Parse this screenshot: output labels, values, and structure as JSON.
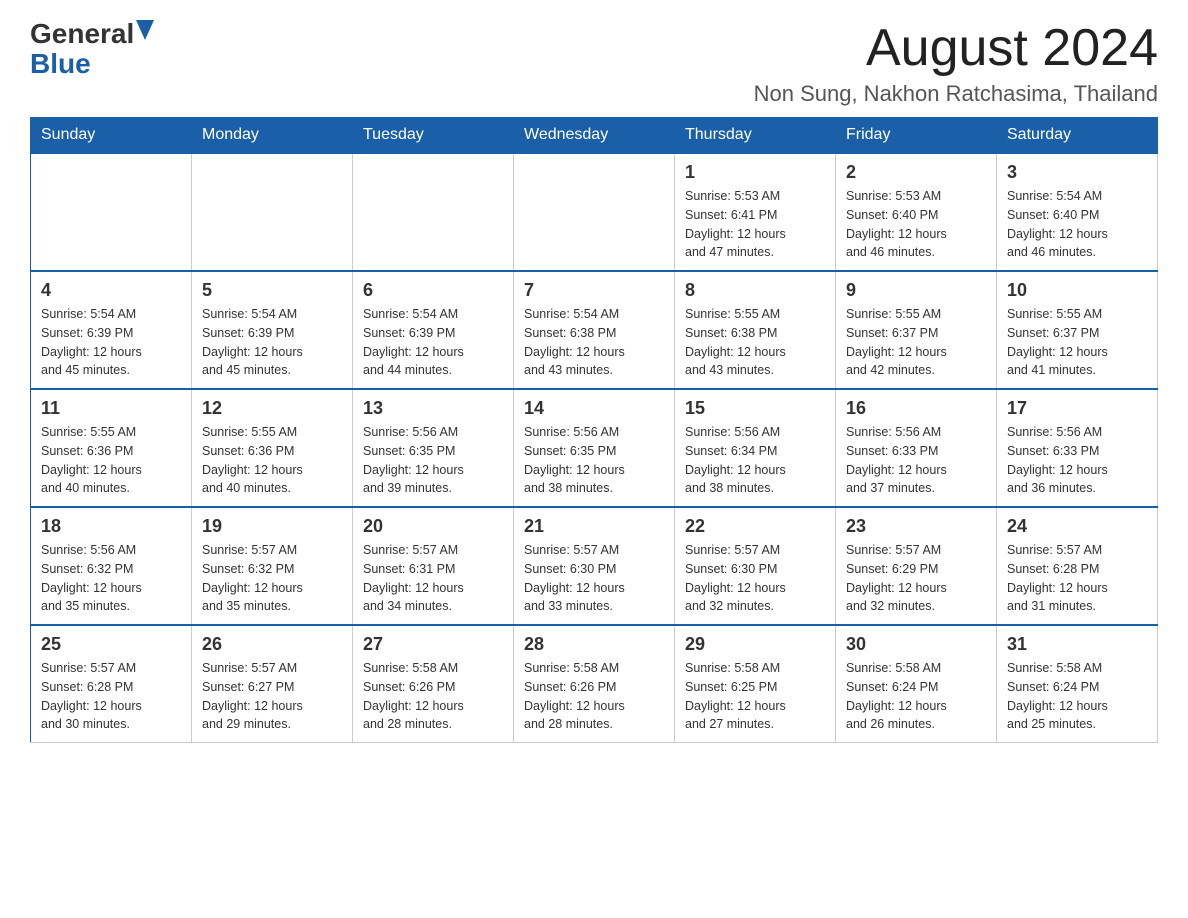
{
  "header": {
    "logo_general": "General",
    "logo_blue": "Blue",
    "title": "August 2024",
    "subtitle": "Non Sung, Nakhon Ratchasima, Thailand"
  },
  "weekdays": [
    "Sunday",
    "Monday",
    "Tuesday",
    "Wednesday",
    "Thursday",
    "Friday",
    "Saturday"
  ],
  "weeks": [
    [
      {
        "day": "",
        "info": ""
      },
      {
        "day": "",
        "info": ""
      },
      {
        "day": "",
        "info": ""
      },
      {
        "day": "",
        "info": ""
      },
      {
        "day": "1",
        "info": "Sunrise: 5:53 AM\nSunset: 6:41 PM\nDaylight: 12 hours\nand 47 minutes."
      },
      {
        "day": "2",
        "info": "Sunrise: 5:53 AM\nSunset: 6:40 PM\nDaylight: 12 hours\nand 46 minutes."
      },
      {
        "day": "3",
        "info": "Sunrise: 5:54 AM\nSunset: 6:40 PM\nDaylight: 12 hours\nand 46 minutes."
      }
    ],
    [
      {
        "day": "4",
        "info": "Sunrise: 5:54 AM\nSunset: 6:39 PM\nDaylight: 12 hours\nand 45 minutes."
      },
      {
        "day": "5",
        "info": "Sunrise: 5:54 AM\nSunset: 6:39 PM\nDaylight: 12 hours\nand 45 minutes."
      },
      {
        "day": "6",
        "info": "Sunrise: 5:54 AM\nSunset: 6:39 PM\nDaylight: 12 hours\nand 44 minutes."
      },
      {
        "day": "7",
        "info": "Sunrise: 5:54 AM\nSunset: 6:38 PM\nDaylight: 12 hours\nand 43 minutes."
      },
      {
        "day": "8",
        "info": "Sunrise: 5:55 AM\nSunset: 6:38 PM\nDaylight: 12 hours\nand 43 minutes."
      },
      {
        "day": "9",
        "info": "Sunrise: 5:55 AM\nSunset: 6:37 PM\nDaylight: 12 hours\nand 42 minutes."
      },
      {
        "day": "10",
        "info": "Sunrise: 5:55 AM\nSunset: 6:37 PM\nDaylight: 12 hours\nand 41 minutes."
      }
    ],
    [
      {
        "day": "11",
        "info": "Sunrise: 5:55 AM\nSunset: 6:36 PM\nDaylight: 12 hours\nand 40 minutes."
      },
      {
        "day": "12",
        "info": "Sunrise: 5:55 AM\nSunset: 6:36 PM\nDaylight: 12 hours\nand 40 minutes."
      },
      {
        "day": "13",
        "info": "Sunrise: 5:56 AM\nSunset: 6:35 PM\nDaylight: 12 hours\nand 39 minutes."
      },
      {
        "day": "14",
        "info": "Sunrise: 5:56 AM\nSunset: 6:35 PM\nDaylight: 12 hours\nand 38 minutes."
      },
      {
        "day": "15",
        "info": "Sunrise: 5:56 AM\nSunset: 6:34 PM\nDaylight: 12 hours\nand 38 minutes."
      },
      {
        "day": "16",
        "info": "Sunrise: 5:56 AM\nSunset: 6:33 PM\nDaylight: 12 hours\nand 37 minutes."
      },
      {
        "day": "17",
        "info": "Sunrise: 5:56 AM\nSunset: 6:33 PM\nDaylight: 12 hours\nand 36 minutes."
      }
    ],
    [
      {
        "day": "18",
        "info": "Sunrise: 5:56 AM\nSunset: 6:32 PM\nDaylight: 12 hours\nand 35 minutes."
      },
      {
        "day": "19",
        "info": "Sunrise: 5:57 AM\nSunset: 6:32 PM\nDaylight: 12 hours\nand 35 minutes."
      },
      {
        "day": "20",
        "info": "Sunrise: 5:57 AM\nSunset: 6:31 PM\nDaylight: 12 hours\nand 34 minutes."
      },
      {
        "day": "21",
        "info": "Sunrise: 5:57 AM\nSunset: 6:30 PM\nDaylight: 12 hours\nand 33 minutes."
      },
      {
        "day": "22",
        "info": "Sunrise: 5:57 AM\nSunset: 6:30 PM\nDaylight: 12 hours\nand 32 minutes."
      },
      {
        "day": "23",
        "info": "Sunrise: 5:57 AM\nSunset: 6:29 PM\nDaylight: 12 hours\nand 32 minutes."
      },
      {
        "day": "24",
        "info": "Sunrise: 5:57 AM\nSunset: 6:28 PM\nDaylight: 12 hours\nand 31 minutes."
      }
    ],
    [
      {
        "day": "25",
        "info": "Sunrise: 5:57 AM\nSunset: 6:28 PM\nDaylight: 12 hours\nand 30 minutes."
      },
      {
        "day": "26",
        "info": "Sunrise: 5:57 AM\nSunset: 6:27 PM\nDaylight: 12 hours\nand 29 minutes."
      },
      {
        "day": "27",
        "info": "Sunrise: 5:58 AM\nSunset: 6:26 PM\nDaylight: 12 hours\nand 28 minutes."
      },
      {
        "day": "28",
        "info": "Sunrise: 5:58 AM\nSunset: 6:26 PM\nDaylight: 12 hours\nand 28 minutes."
      },
      {
        "day": "29",
        "info": "Sunrise: 5:58 AM\nSunset: 6:25 PM\nDaylight: 12 hours\nand 27 minutes."
      },
      {
        "day": "30",
        "info": "Sunrise: 5:58 AM\nSunset: 6:24 PM\nDaylight: 12 hours\nand 26 minutes."
      },
      {
        "day": "31",
        "info": "Sunrise: 5:58 AM\nSunset: 6:24 PM\nDaylight: 12 hours\nand 25 minutes."
      }
    ]
  ]
}
